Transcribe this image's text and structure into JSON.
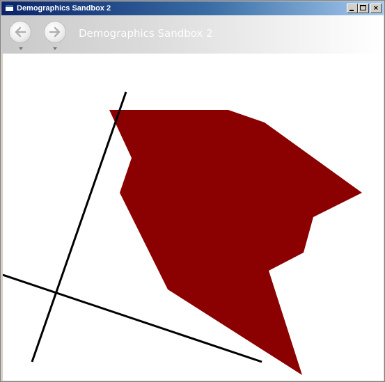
{
  "window": {
    "title": "Demographics Sandbox 2",
    "buttons": {
      "minimize": "minimize",
      "maximize": "maximize",
      "close": "×"
    }
  },
  "navbar": {
    "page_title": "Demographics Sandbox 2",
    "back_icon": "arrow-left-icon",
    "forward_icon": "arrow-right-icon"
  },
  "canvas": {
    "shape_color": "#8b0000",
    "line_color": "#000000"
  }
}
